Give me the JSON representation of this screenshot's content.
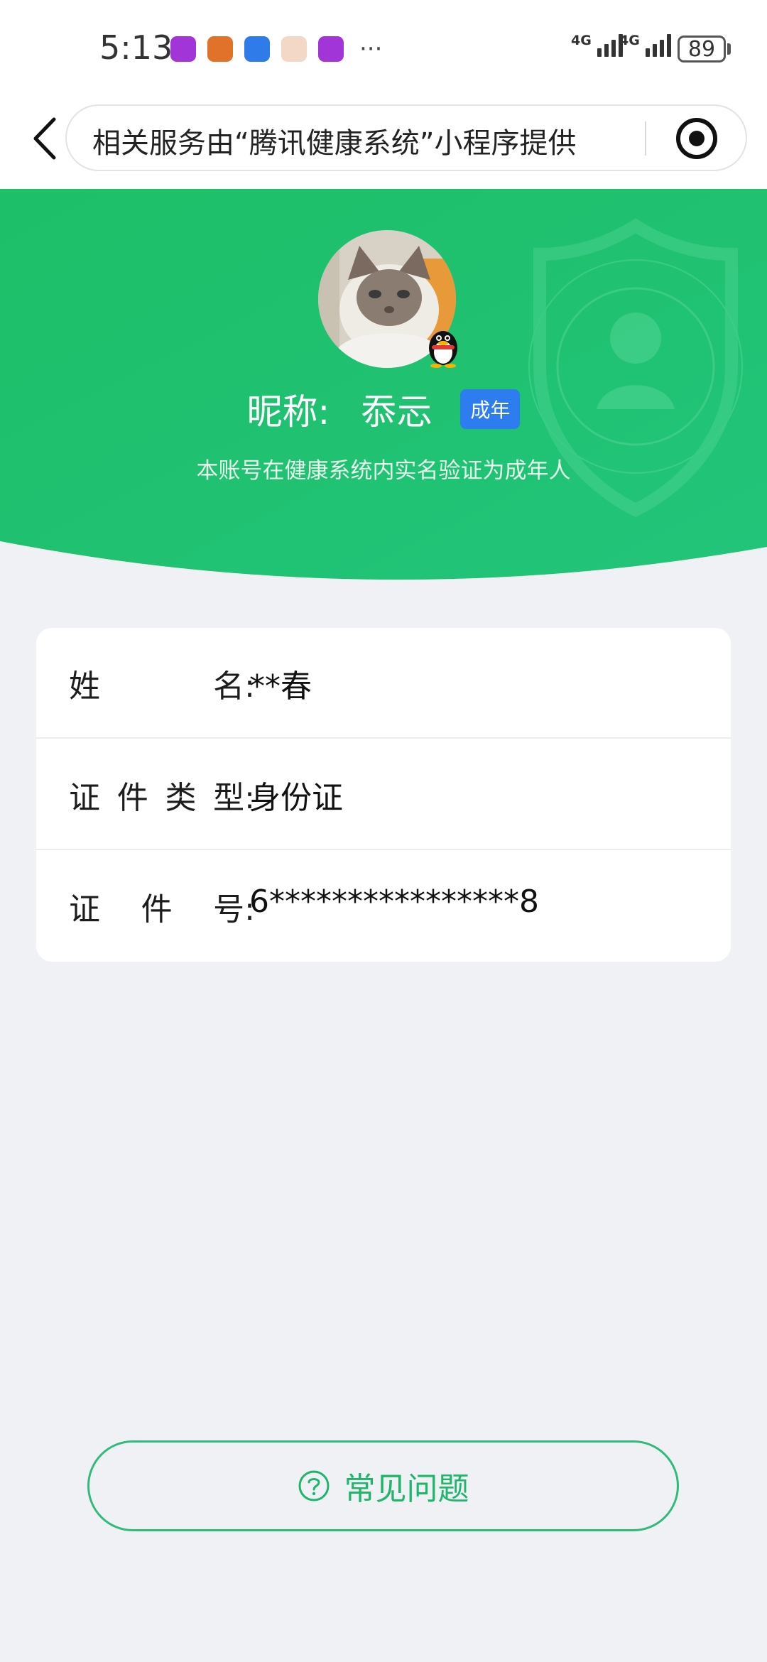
{
  "status_bar": {
    "time": "5:13",
    "network_1": "4G",
    "network_2": "4G",
    "battery": "89",
    "more": "···"
  },
  "nav": {
    "title": "相关服务由“腾讯健康系统”小程序提供"
  },
  "profile": {
    "nickname_label": "昵称:",
    "nickname": "忝忈",
    "badge": "成年",
    "verify_text": "本账号在健康系统内实名验证为成年人"
  },
  "info": {
    "rows": [
      {
        "label_chars": [
          "姓",
          "名:"
        ],
        "value": "**春"
      },
      {
        "label_chars": [
          "证",
          "件",
          "类",
          "型:"
        ],
        "value": "身份证"
      },
      {
        "label_chars": [
          "证",
          "件",
          "号:"
        ],
        "value": "6****************8"
      }
    ]
  },
  "faq": {
    "label": "常见问题"
  },
  "colors": {
    "header_green": "#1fc16f",
    "badge_blue": "#2d7df0",
    "faq_green": "#1fb56b",
    "page_bg": "#eff1f5"
  }
}
